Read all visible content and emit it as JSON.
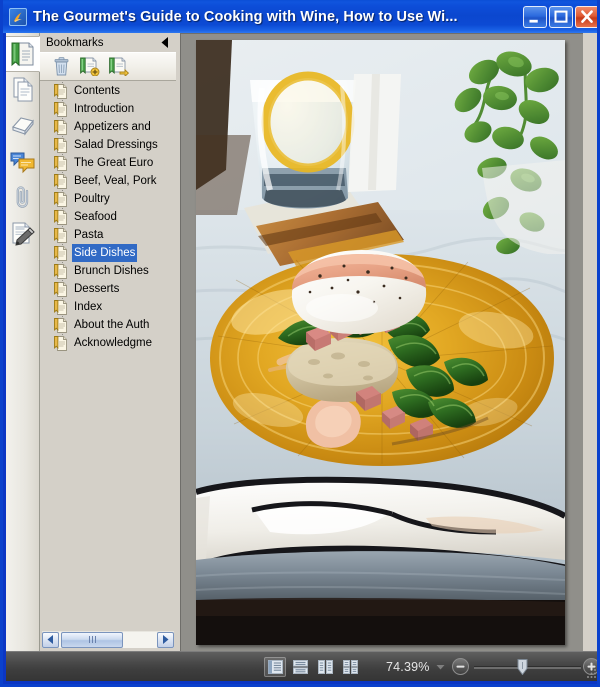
{
  "window": {
    "title": "The Gourmet's Guide to Cooking with Wine, How to Use Wi...",
    "app_icon": "foxit-reader-icon",
    "controls": {
      "minimize": "minimize-button",
      "maximize": "maximize-button",
      "close": "close-button"
    },
    "colors": {
      "titlebar_blue": "#0b47cf",
      "frame_blue": "#0b41cc",
      "chrome_gray": "#d4d0c8",
      "selection_blue": "#316ac5",
      "statusbar_dark": "#3e3e3e",
      "doc_background": "#908f8a"
    }
  },
  "icon_rail": {
    "items": [
      {
        "name": "bookmarks-pane-icon",
        "label": "Bookmarks",
        "active": true
      },
      {
        "name": "pages-pane-icon",
        "label": "Pages",
        "active": false
      },
      {
        "name": "layers-pane-icon",
        "label": "Layers",
        "active": false
      },
      {
        "name": "comments-pane-icon",
        "label": "Comments",
        "active": false
      },
      {
        "name": "attachments-pane-icon",
        "label": "Attachments",
        "active": false
      },
      {
        "name": "signatures-pane-icon",
        "label": "Signatures",
        "active": false
      }
    ]
  },
  "bookmarks_panel": {
    "header": "Bookmarks",
    "collapse_icon": "chevron-left-icon",
    "toolbar": [
      {
        "name": "delete-bookmark-button",
        "icon": "trash-icon",
        "label": "Delete"
      },
      {
        "name": "new-bookmark-button",
        "icon": "new-bookmark-icon",
        "label": "New Bookmark"
      },
      {
        "name": "expand-bookmark-button",
        "icon": "expand-bookmark-icon",
        "label": "Expand Current Bookmark"
      }
    ],
    "items": [
      {
        "label": "Contents",
        "selected": false
      },
      {
        "label": "Introduction",
        "selected": false
      },
      {
        "label": "Appetizers and",
        "selected": false
      },
      {
        "label": "Salad Dressings",
        "selected": false
      },
      {
        "label": "The Great Euro",
        "selected": false
      },
      {
        "label": "Beef, Veal, Pork",
        "selected": false
      },
      {
        "label": "Poultry",
        "selected": false
      },
      {
        "label": "Seafood",
        "selected": false
      },
      {
        "label": "Pasta",
        "selected": false
      },
      {
        "label": "Side Dishes",
        "selected": true
      },
      {
        "label": "Brunch Dishes",
        "selected": false
      },
      {
        "label": "Desserts",
        "selected": false
      },
      {
        "label": "Index",
        "selected": false
      },
      {
        "label": "About the Auth",
        "selected": false
      },
      {
        "label": "Acknowledgme",
        "selected": false
      }
    ],
    "hscrollbar": {
      "left_arrow": "scroll-left-arrow",
      "right_arrow": "scroll-right-arrow"
    }
  },
  "document": {
    "page_content": "food-photograph-eggs-benedict-on-amber-glass-plate",
    "vscrollbar": {
      "up_arrow": "scroll-up-arrow",
      "down_arrow": "scroll-down-arrow"
    }
  },
  "statusbar": {
    "view_modes": [
      {
        "name": "single-page-view-button",
        "icon": "single-page-icon",
        "active": true
      },
      {
        "name": "continuous-view-button",
        "icon": "continuous-page-icon",
        "active": false
      },
      {
        "name": "facing-view-button",
        "icon": "two-up-page-icon",
        "active": false
      },
      {
        "name": "continuous-facing-view-button",
        "icon": "grid-page-icon",
        "active": false
      }
    ],
    "zoom_level": "74.39%",
    "zoom_dropdown_icon": "chevron-down-icon",
    "zoom_out_icon": "minus-icon",
    "zoom_in_icon": "plus-icon",
    "slider_position_percent": 40
  }
}
